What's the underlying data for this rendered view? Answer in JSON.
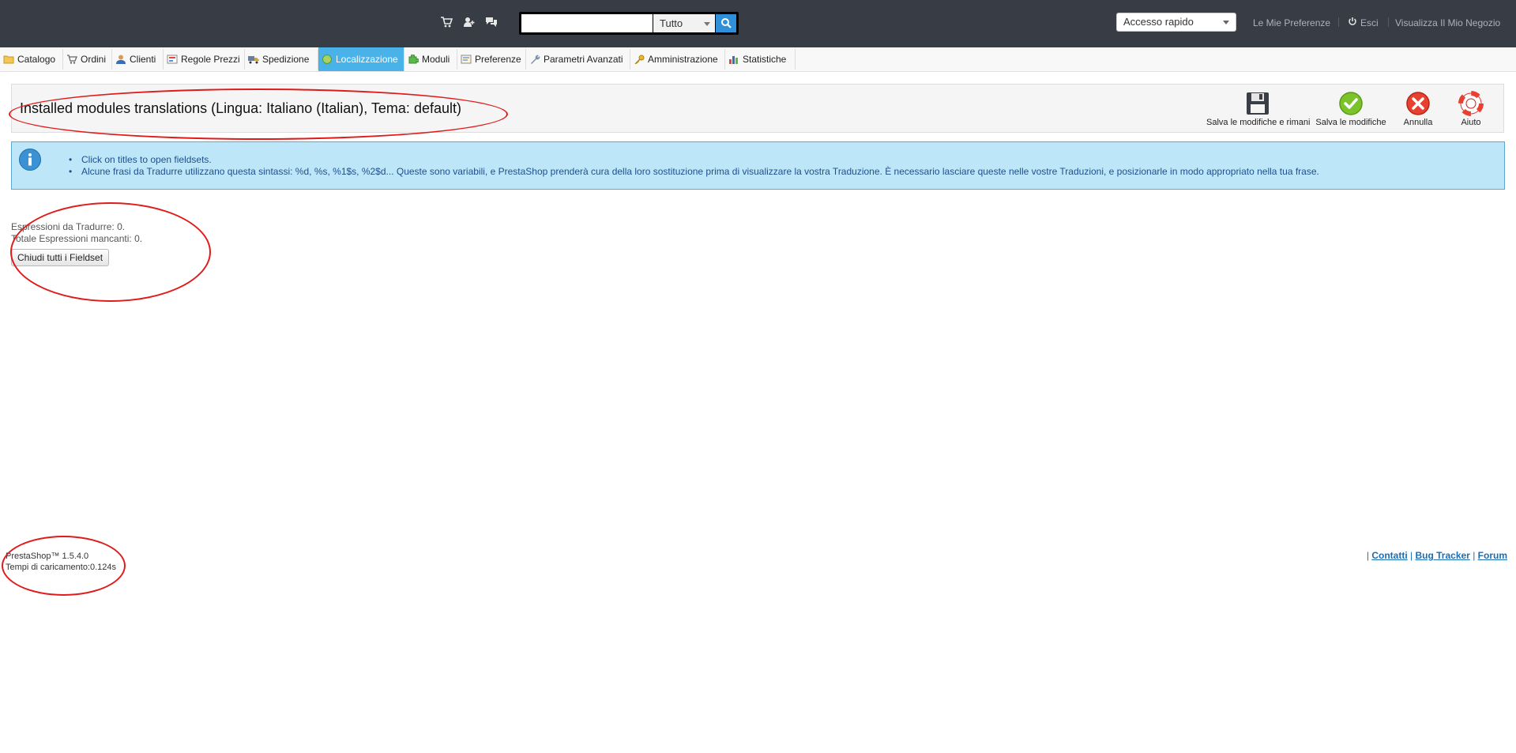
{
  "header": {
    "icons": [
      "cart-icon",
      "user-icon",
      "messages-icon"
    ],
    "search": {
      "placeholder": "",
      "scope_value": "Tutto"
    },
    "quick_access": "Accesso rapido",
    "links": {
      "preferences": "Le Mie Preferenze",
      "logout": "Esci",
      "view_shop": "Visualizza Il Mio Negozio"
    }
  },
  "menu": {
    "items": [
      {
        "label": "Catalogo",
        "icon": "folder-icon"
      },
      {
        "label": "Ordini",
        "icon": "cart-icon"
      },
      {
        "label": "Clienti",
        "icon": "customer-icon"
      },
      {
        "label": "Regole Prezzi",
        "icon": "price-rules-icon"
      },
      {
        "label": "Spedizione",
        "icon": "truck-icon"
      },
      {
        "label": "Localizzazione",
        "icon": "globe-icon"
      },
      {
        "label": "Moduli",
        "icon": "puzzle-icon"
      },
      {
        "label": "Preferenze",
        "icon": "preferences-icon"
      },
      {
        "label": "Parametri Avanzati",
        "icon": "wrench-icon"
      },
      {
        "label": "Amministrazione",
        "icon": "key-icon"
      },
      {
        "label": "Statistiche",
        "icon": "chart-icon"
      }
    ],
    "active": "Localizzazione"
  },
  "toolbar": {
    "title": "Installed modules translations (Lingua: Italiano (Italian), Tema: default)",
    "buttons": {
      "save_stay": "Salva le modifiche e rimani",
      "save": "Salva le modifiche",
      "cancel": "Annulla",
      "help": "Aiuto"
    }
  },
  "info": {
    "items": [
      "Click on titles to open fieldsets.",
      "Alcune frasi da Tradurre utilizzano questa sintassi: %d, %s, %1$s, %2$d... Queste sono variabili, e PrestaShop prenderà cura della loro sostituzione prima di visualizzare la vostra Traduzione. È necessario lasciare queste nelle vostre Traduzioni, e posizionarle in modo appropriato nella tua frase."
    ]
  },
  "stats": {
    "to_translate": "Espressioni da Tradurre: 0.",
    "missing": "Totale Espressioni mancanti: 0."
  },
  "collapse_button": "Chiudi tutti i Fieldset",
  "footer": {
    "version": "PrestaShop™ 1.5.4.0",
    "load_time": "Tempi di caricamento:0.124s",
    "links": {
      "contacts": "Contatti",
      "bug_tracker": "Bug Tracker",
      "forum": "Forum"
    },
    "separator": "|"
  },
  "colors": {
    "header_bg": "#383d45",
    "menu_active": "#49b2e9",
    "info_bg": "#bde6f9",
    "annotation": "#e01b1b"
  }
}
